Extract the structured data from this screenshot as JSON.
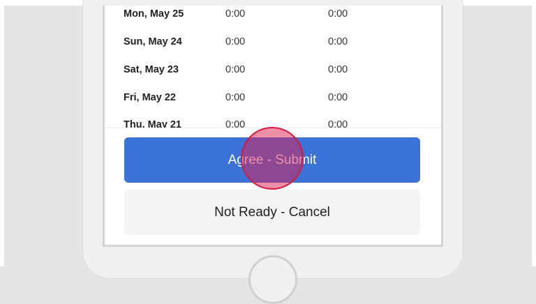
{
  "timesheet": {
    "rows": [
      {
        "day": "Mon, May 25",
        "col1": "0:00",
        "col2": "0:00"
      },
      {
        "day": "Sun, May 24",
        "col1": "0:00",
        "col2": "0:00"
      },
      {
        "day": "Sat, May 23",
        "col1": "0:00",
        "col2": "0:00"
      },
      {
        "day": "Fri, May 22",
        "col1": "0:00",
        "col2": "0:00"
      },
      {
        "day": "Thu, May 21",
        "col1": "0:00",
        "col2": "0:00"
      }
    ]
  },
  "actions": {
    "submit_label": "Agree - Submit",
    "cancel_label": "Not Ready - Cancel"
  },
  "colors": {
    "primary": "#3a72d7",
    "secondary_bg": "#f4f4f4",
    "tap_indicator": "#d5193f"
  }
}
